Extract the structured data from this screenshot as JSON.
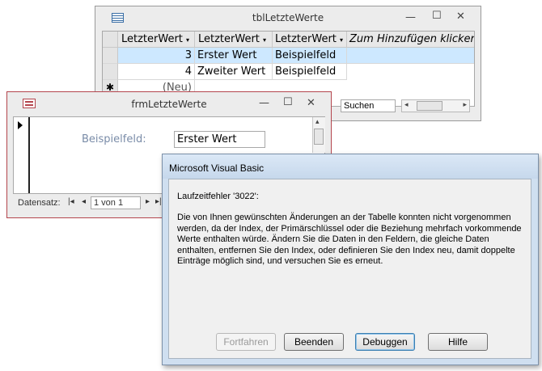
{
  "table_window": {
    "title": "tblLetzteWerte",
    "icon": "table-icon",
    "columns": [
      "LetzterWert",
      "LetzterWert",
      "LetzterWert",
      "Zum Hinzufügen klicken"
    ],
    "rows": [
      [
        "3",
        "Erster Wert",
        "Beispielfeld"
      ],
      [
        "4",
        "Zweiter Wert",
        "Beispielfeld"
      ]
    ],
    "new_row": "(Neu)",
    "new_row_marker": "✱",
    "search_label": "Suchen",
    "selected_row_color": "#cde8ff"
  },
  "form_window": {
    "title": "frmLetzteWerte",
    "icon": "form-icon",
    "field_label": "Beispielfeld:",
    "field_value": "Erster Wert",
    "nav_label": "Datensatz:",
    "record_position": "1 von 1",
    "accent_color": "#b4454d"
  },
  "dialog": {
    "title": "Microsoft Visual Basic",
    "error_title": "Laufzeitfehler '3022':",
    "message": "Die von Ihnen gewünschten Änderungen an der Tabelle konnten nicht vorgenommen werden, da der Index, der Primärschlüssel oder die Beziehung mehrfach vorkommende Werte enthalten würde. Ändern Sie die Daten in den Feldern, die gleiche Daten enthalten, entfernen Sie den Index, oder definieren Sie den Index neu, damit doppelte Einträge möglich sind, und versuchen Sie es erneut.",
    "buttons": {
      "continue": "Fortfahren",
      "end": "Beenden",
      "debug": "Debuggen",
      "help": "Hilfe"
    }
  },
  "window_controls": {
    "minimize": "—",
    "maximize": "☐",
    "close": "✕"
  }
}
